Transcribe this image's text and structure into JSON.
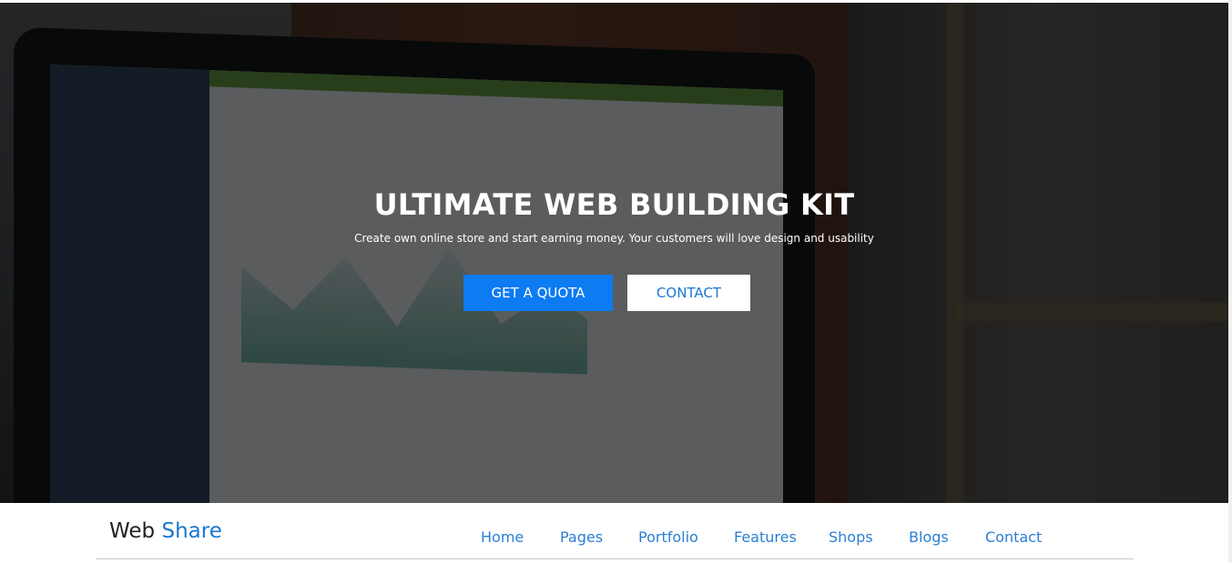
{
  "hero": {
    "title": "ULTIMATE WEB BUILDING KIT",
    "subtitle": "Create own online store and start earning money. Your customers will love design and usability",
    "primary_button": "GET A QUOTA",
    "secondary_button": "CONTACT"
  },
  "brand": {
    "part1": "Web",
    "part2": "Share"
  },
  "nav": {
    "items": [
      "Home",
      "Pages",
      "Portfolio",
      "Features",
      "Shops",
      "Blogs",
      "Contact"
    ]
  },
  "colors": {
    "accent": "#1877d2",
    "primary_button": "#0d7bf2"
  }
}
